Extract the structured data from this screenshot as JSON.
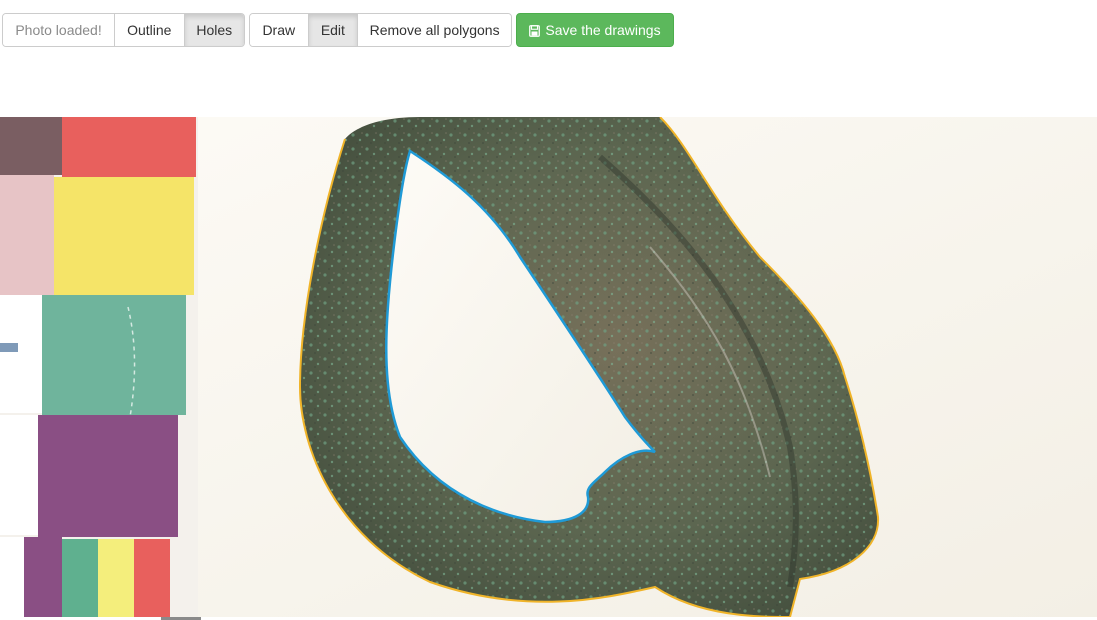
{
  "toolbar": {
    "photo_status": "Photo loaded!",
    "mode_outline": "Outline",
    "mode_holes": "Holes",
    "action_draw": "Draw",
    "action_edit": "Edit",
    "remove_all": "Remove all polygons",
    "save": "Save the drawings",
    "save_icon": "floppy-disk-icon"
  },
  "colors": {
    "outline_polygon": "#f0b429",
    "hole_polygon": "#1f9ad6",
    "save_button": "#5cb85c"
  },
  "canvas": {
    "image": "photo of a corroded bronze ring artifact beside a colour calibration card",
    "polygons": [
      "outline",
      "hole"
    ]
  }
}
